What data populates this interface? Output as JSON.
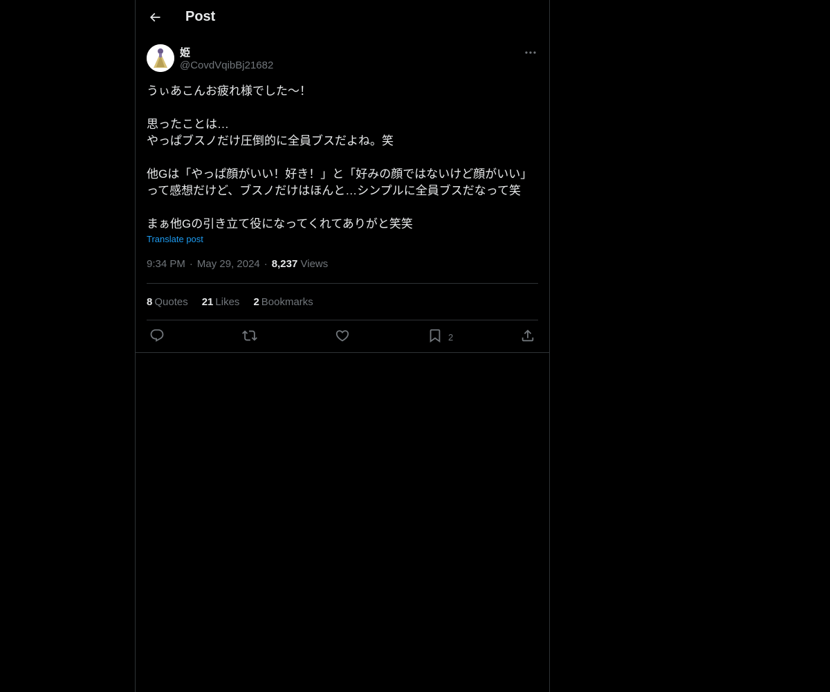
{
  "header": {
    "title": "Post",
    "back_icon": "arrow-left-icon"
  },
  "post": {
    "author": {
      "name": "姫",
      "handle": "@CovdVqibBj21682",
      "avatar_icon": "avatar-figure-icon"
    },
    "more_icon": "more-horizontal-icon",
    "text_lines": [
      "うぃあこんお疲れ様でした〜！",
      "",
      "思ったことは…",
      "やっぱブスノだけ圧倒的に全員ブスだよね。笑",
      "",
      "他Gは「やっぱ顔がいい！好き！」と「好みの顔ではないけど顔がいい」",
      "って感想だけど、ブスノだけはほんと…シンプルに全員ブスだなって笑",
      "",
      "まぁ他Gの引き立て役になってくれてありがと笑笑"
    ],
    "translate_label": "Translate post",
    "time": "9:34 PM",
    "separator": "·",
    "date": "May 29, 2024",
    "views_count": "8,237",
    "views_label": "Views",
    "stats": {
      "quotes_count": "8",
      "quotes_label": "Quotes",
      "likes_count": "21",
      "likes_label": "Likes",
      "bookmarks_count": "2",
      "bookmarks_label": "Bookmarks"
    },
    "actions": {
      "reply_icon": "reply-icon",
      "repost_icon": "repost-icon",
      "like_icon": "heart-icon",
      "bookmark_icon": "bookmark-icon",
      "bookmark_count": "2",
      "share_icon": "share-icon"
    }
  },
  "colors": {
    "background": "#000000",
    "text_primary": "#e7e9ea",
    "text_secondary": "#71767b",
    "link": "#1d9bf0",
    "border": "#2f3336"
  }
}
